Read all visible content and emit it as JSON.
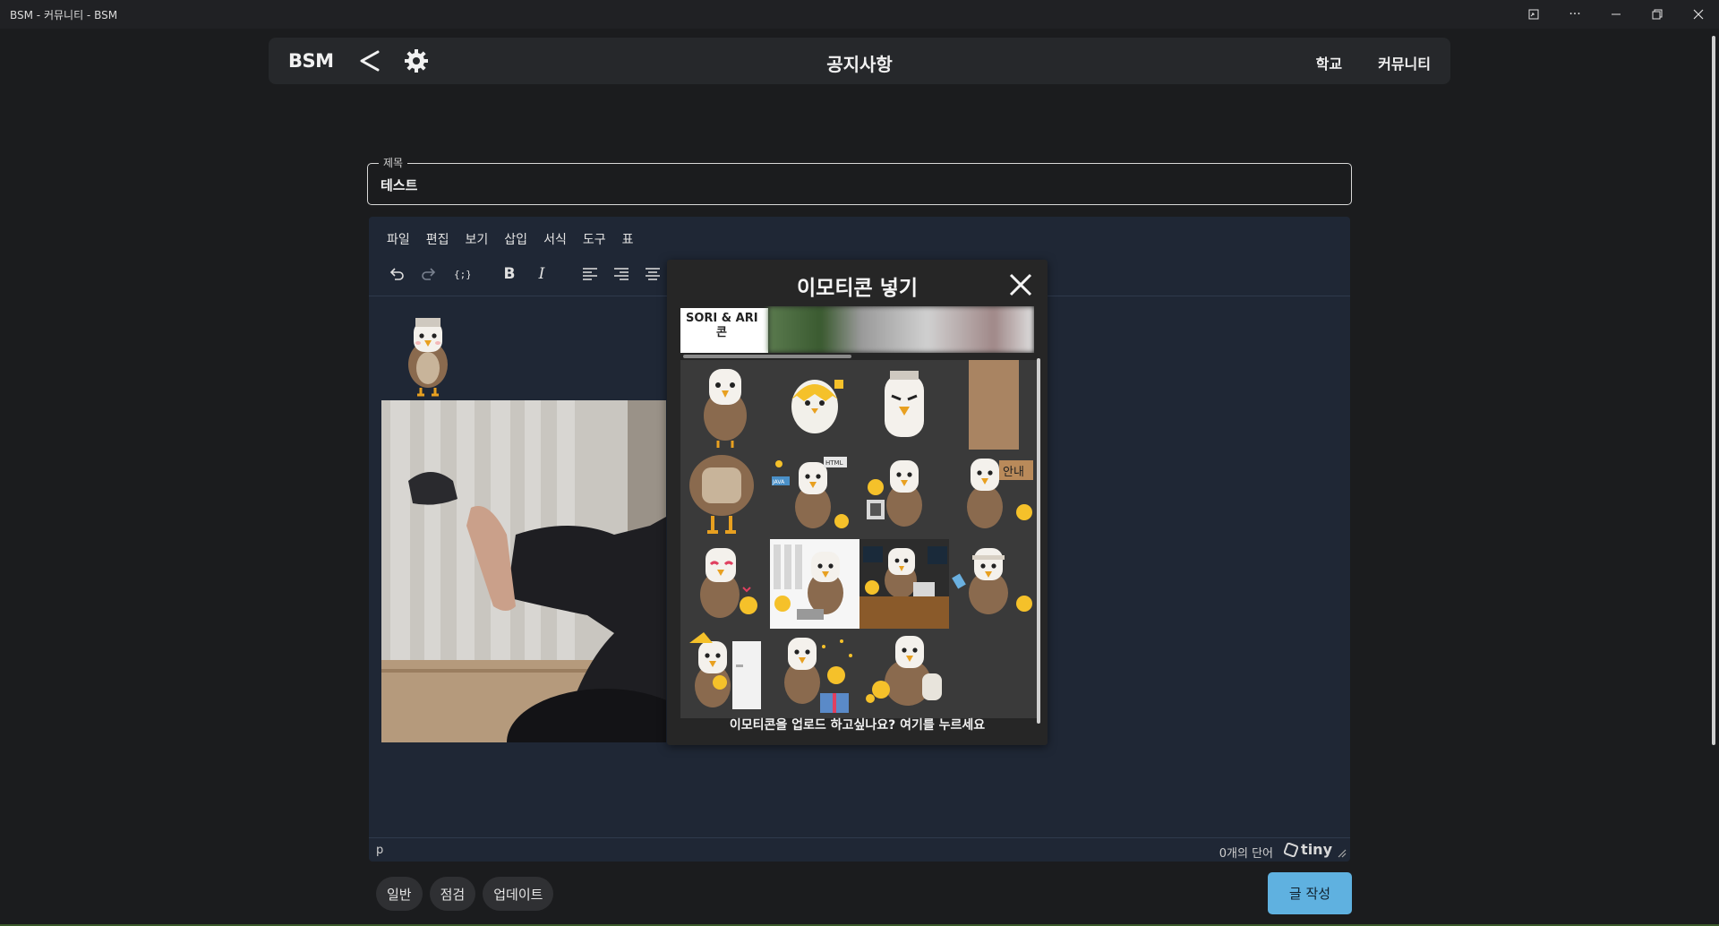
{
  "window": {
    "title": "BSM - 커뮤니티 - BSM",
    "controls": {
      "more": "···"
    }
  },
  "nav": {
    "brand": "BSM",
    "page_title": "공지사항",
    "links": [
      "학교",
      "커뮤니티"
    ]
  },
  "post": {
    "title_label": "제목",
    "title_value": "테스트"
  },
  "editor": {
    "menu": [
      "파일",
      "편집",
      "보기",
      "삽입",
      "서식",
      "도구",
      "표"
    ],
    "toolbar": {
      "undo": "undo-icon",
      "redo": "redo-icon",
      "source": "code-icon",
      "bold": "B",
      "italic": "I",
      "align_left": "align-left-icon",
      "align_right": "align-right-icon",
      "align_center": "align-center-icon"
    },
    "status": {
      "path": "p",
      "word_count": "0개의 단어",
      "brand": "tiny"
    }
  },
  "emoticon_modal": {
    "title": "이모티콘 넣기",
    "pack_tab": {
      "line1": "SORI & ARI",
      "line2": "콘"
    },
    "signs": {
      "guide": "안내",
      "html": "HTML",
      "java": "JAVA"
    },
    "footer": "이모티콘을 업로드 하고싶나요? 여기를 누르세요",
    "item_count": 15
  },
  "categories": [
    "일반",
    "점검",
    "업데이트"
  ],
  "submit_label": "글 작성",
  "colors": {
    "accent": "#5fb1e0",
    "editor_bg": "#1f2735",
    "page_bg": "#1b1c1e"
  }
}
